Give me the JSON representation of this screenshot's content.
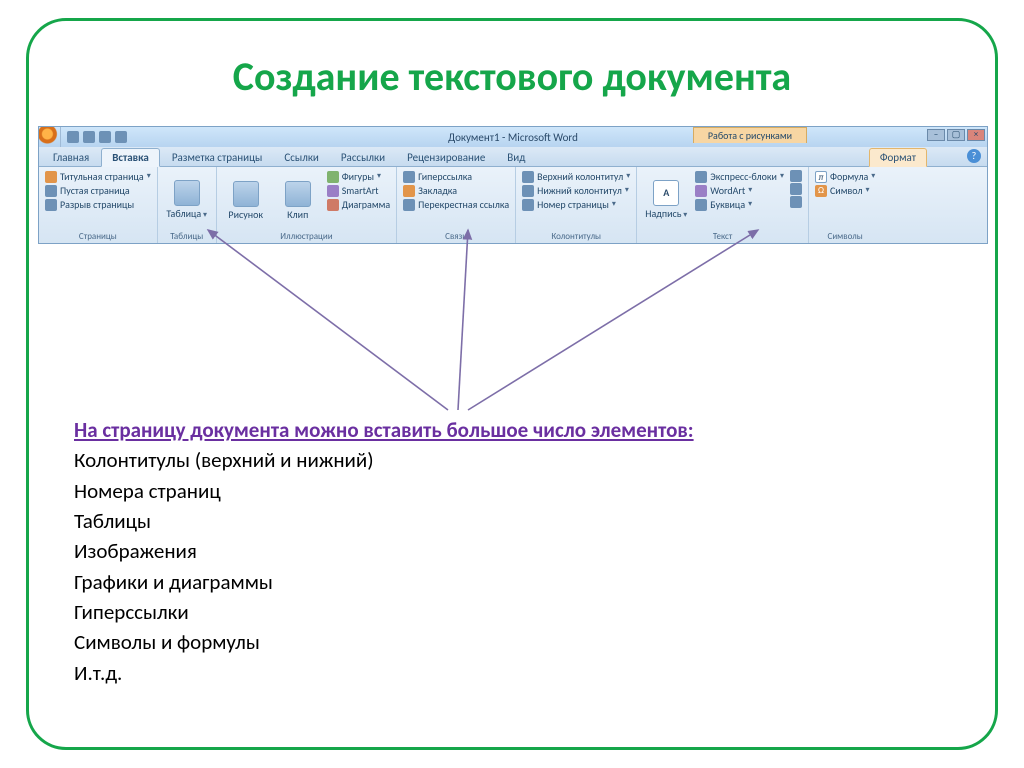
{
  "slide": {
    "title": "Создание текстового документа"
  },
  "word": {
    "doc_title": "Документ1 - Microsoft Word",
    "context_group": "Работа с рисунками",
    "tabs": {
      "home": "Главная",
      "insert": "Вставка",
      "layout": "Разметка страницы",
      "references": "Ссылки",
      "mailings": "Рассылки",
      "review": "Рецензирование",
      "view": "Вид",
      "format": "Формат"
    },
    "groups": {
      "pages": {
        "label": "Страницы",
        "cover": "Титульная страница",
        "blank": "Пустая страница",
        "break": "Разрыв страницы"
      },
      "tables": {
        "label": "Таблицы",
        "table": "Таблица"
      },
      "illustrations": {
        "label": "Иллюстрации",
        "picture": "Рисунок",
        "clip": "Клип",
        "shapes": "Фигуры",
        "smartart": "SmartArt",
        "chart": "Диаграмма"
      },
      "links": {
        "label": "Связи",
        "hyperlink": "Гиперссылка",
        "bookmark": "Закладка",
        "crossref": "Перекрестная ссылка"
      },
      "headerfooter": {
        "label": "Колонтитулы",
        "header": "Верхний колонтитул",
        "footer": "Нижний колонтитул",
        "pagenum": "Номер страницы"
      },
      "text": {
        "label": "Текст",
        "textbox": "Надпись",
        "quickparts": "Экспресс-блоки",
        "wordart": "WordArt",
        "dropcap": "Буквица"
      },
      "symbols": {
        "label": "Символы",
        "equation": "Формула",
        "symbol": "Символ"
      }
    }
  },
  "content": {
    "lead": "На страницу документа можно вставить большое число элементов:",
    "items": [
      "Колонтитулы (верхний и нижний)",
      "Номера страниц",
      "Таблицы",
      "Изображения",
      "Графики и диаграммы",
      "Гиперссылки",
      "Символы и формулы",
      "И.т.д."
    ]
  }
}
